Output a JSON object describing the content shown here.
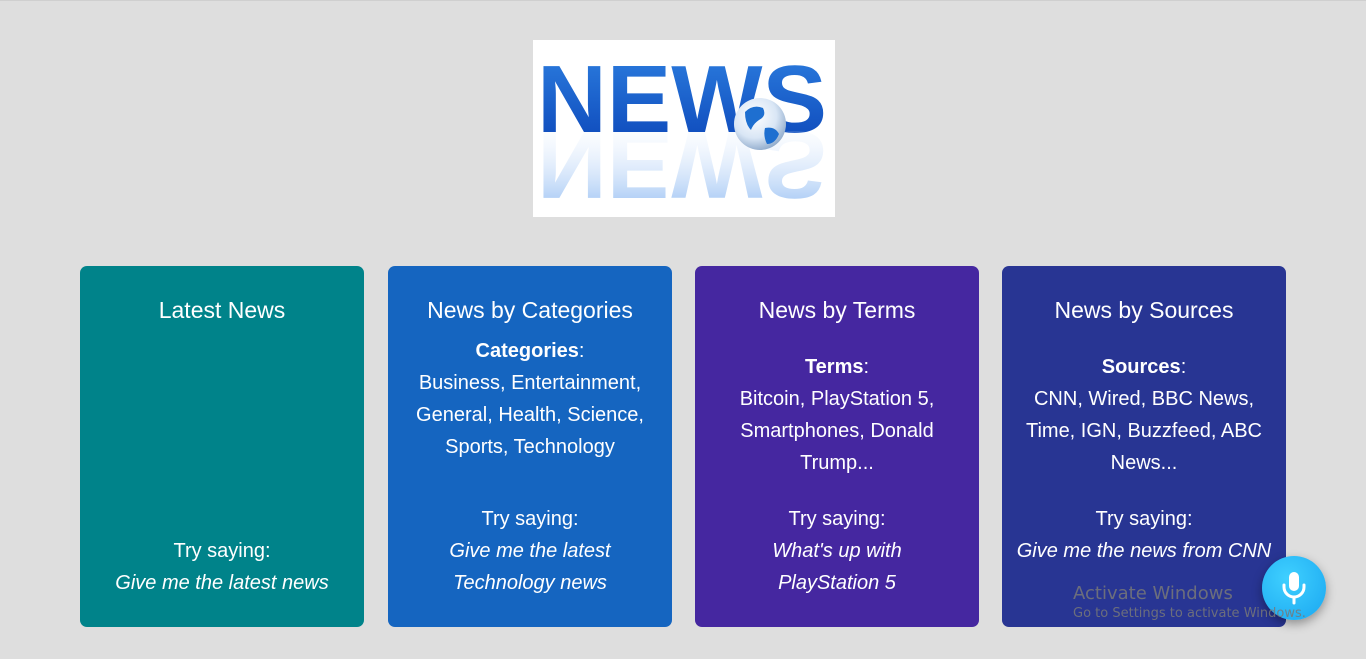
{
  "logo": {
    "icon": "news-globe-logo"
  },
  "cards": [
    {
      "title": "Latest News",
      "try_label": "Try saying:",
      "example": "Give me the latest news",
      "color": "#00838a"
    },
    {
      "title": "News by Categories",
      "info_label": "Categories",
      "info_text": "Business, Entertainment, General, Health, Science, Sports, Technology",
      "try_label": "Try saying:",
      "example": "Give me the latest Technology news",
      "color": "#1565c0"
    },
    {
      "title": "News by Terms",
      "info_label": "Terms",
      "info_text": "Bitcoin, PlayStation 5, Smartphones, Donald Trump...",
      "try_label": "Try saying:",
      "example": "What's up with PlayStation 5",
      "color": "#4527a0"
    },
    {
      "title": "News by Sources",
      "info_label": "Sources",
      "info_text": "CNN, Wired, BBC News, Time, IGN, Buzzfeed, ABC News...",
      "try_label": "Try saying:",
      "example": "Give me the news from CNN",
      "color": "#283593"
    }
  ],
  "mic_button": {
    "icon": "microphone-icon",
    "color": "#1aa6f0"
  },
  "watermark": {
    "title": "Activate Windows",
    "subtitle": "Go to Settings to activate Windows."
  }
}
